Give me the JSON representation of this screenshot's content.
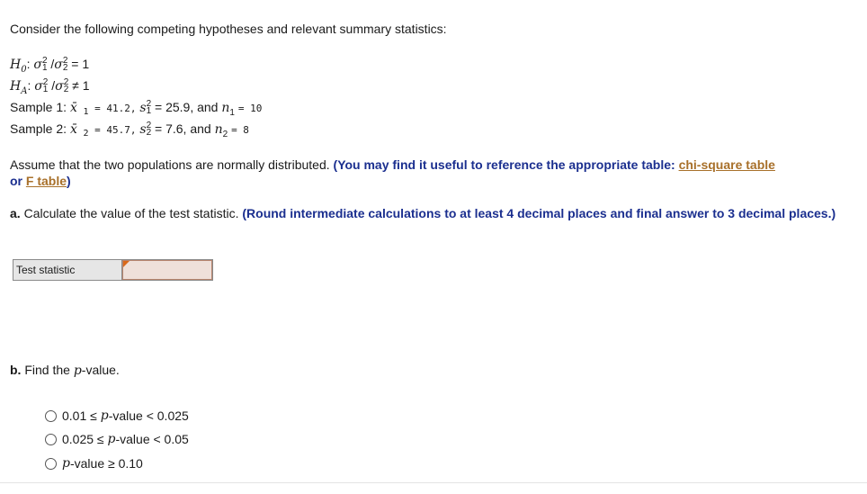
{
  "intro": "Consider the following competing hypotheses and relevant summary statistics:",
  "h0": {
    "label": "H0",
    "ratio": "σ1²/σ2²",
    "rel": "= 1"
  },
  "ha": {
    "label": "HA",
    "ratio": "σ1²/σ2²",
    "rel": "≠ 1"
  },
  "sample1": {
    "label": "Sample 1:",
    "xbar": "= 41.2,",
    "s2": "= 25.9, and",
    "n": "= 10"
  },
  "sample2": {
    "label": "Sample 2:",
    "xbar": "= 45.7,",
    "s2": "= 7.6, and",
    "n": "= 8"
  },
  "assume": {
    "text": "Assume that the two populations are normally distributed.",
    "bold": "(You may find it useful to reference the appropriate table:",
    "link1": "chi-square table",
    "or": "or",
    "link2": "F table",
    "close": ")"
  },
  "part_a": {
    "label": "a.",
    "text": "Calculate the value of the test statistic.",
    "bold": "(Round intermediate calculations to at least 4 decimal places and final answer to 3 decimal places.)"
  },
  "test_stat": {
    "label": "Test statistic",
    "value": ""
  },
  "part_b": {
    "label": "b.",
    "text_pre": "Find the",
    "italic": "p",
    "text_post": "-value."
  },
  "options": [
    {
      "pre": "0.01 ≤",
      "p": "p",
      "post": "-value < 0.025"
    },
    {
      "pre": "0.025 ≤",
      "p": "p",
      "post": "-value < 0.05"
    },
    {
      "pre": "",
      "p": "p",
      "post": "-value ≥ 0.10"
    }
  ]
}
